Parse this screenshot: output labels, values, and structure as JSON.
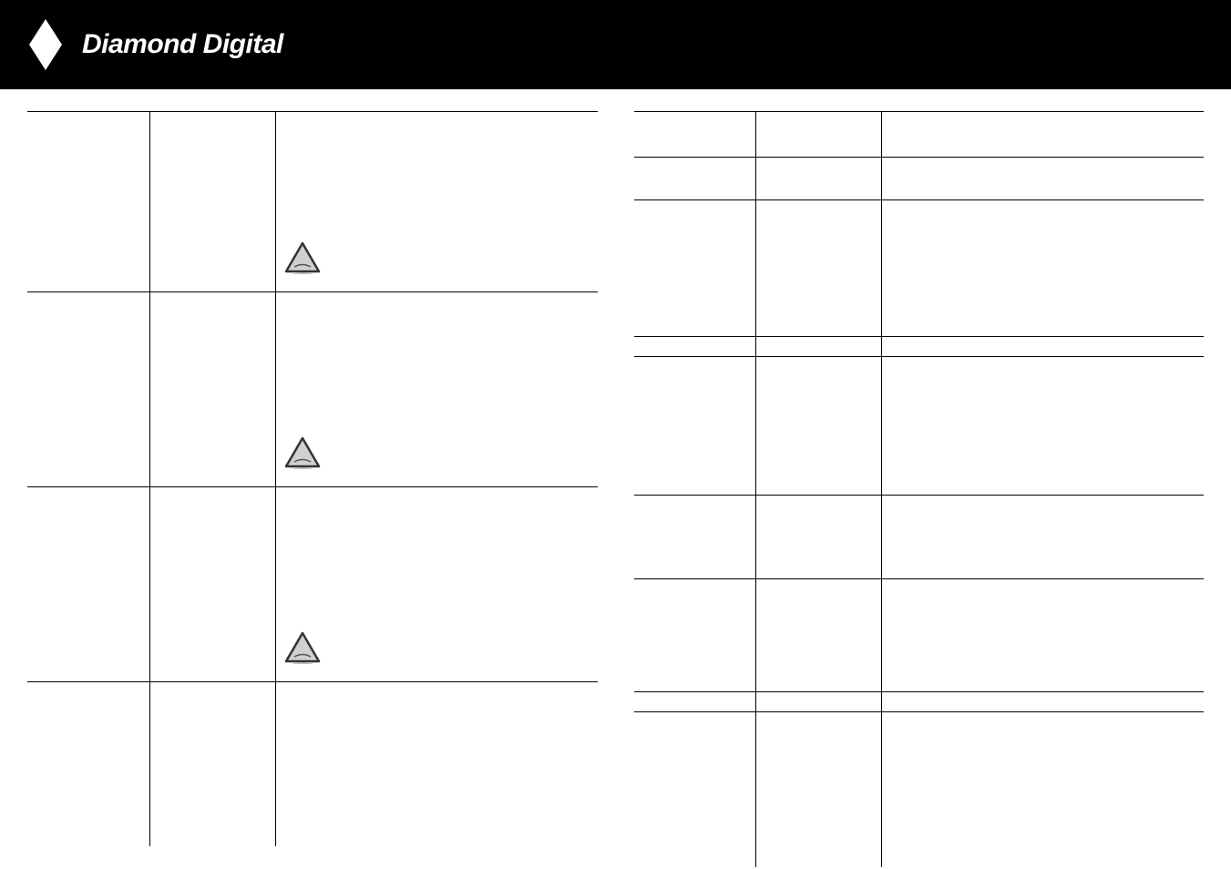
{
  "header": {
    "title": "Diamond Digital"
  },
  "icons": {
    "diamond": "diamond-icon",
    "warning": "warning-triangle-icon"
  }
}
